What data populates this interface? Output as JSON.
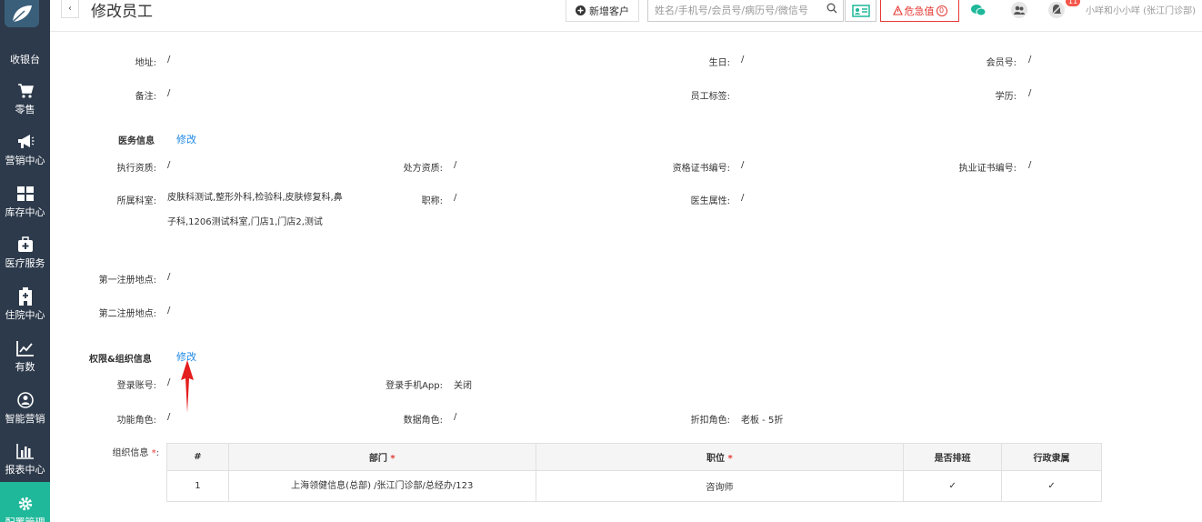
{
  "sidebar": {
    "items": [
      {
        "label": "收银台",
        "icon": "cashier-icon"
      },
      {
        "label": "零售",
        "icon": "cart-icon"
      },
      {
        "label": "营销中心",
        "icon": "megaphone-icon"
      },
      {
        "label": "库存中心",
        "icon": "grid-icon"
      },
      {
        "label": "医疗服务",
        "icon": "medkit-icon"
      },
      {
        "label": "住院中心",
        "icon": "hospital-icon"
      },
      {
        "label": "有数",
        "icon": "trend-icon"
      },
      {
        "label": "智能营销",
        "icon": "people-icon"
      },
      {
        "label": "报表中心",
        "icon": "bar-chart-icon"
      },
      {
        "label": "配置管理",
        "icon": "gear-icon"
      }
    ]
  },
  "header": {
    "title": "修改员工",
    "new_customer": "新增客户",
    "search_placeholder": "姓名/手机号/会员号/病历号/微信号",
    "critical_value": "危急值",
    "critical_count": "0",
    "user": "小咩和小小咩 (张江门诊部)",
    "badge": "11"
  },
  "basic": {
    "address_label": "地址:",
    "address_value": "/",
    "birthday_label": "生日:",
    "birthday_value": "/",
    "member_no_label": "会员号:",
    "member_no_value": "/",
    "remark_label": "备注:",
    "remark_value": "/",
    "staff_tag_label": "员工标签:",
    "education_label": "学历:",
    "education_value": "/"
  },
  "medical": {
    "section_title": "医务信息",
    "edit_link": "修改",
    "practice_qual_label": "执行资质:",
    "practice_qual_value": "/",
    "prescription_qual_label": "处方资质:",
    "prescription_qual_value": "/",
    "cert_no_label": "资格证书编号:",
    "cert_no_value": "/",
    "license_no_label": "执业证书编号:",
    "license_no_value": "/",
    "dept_label": "所属科室:",
    "dept_value": "皮肤科测试,整形外科,检验科,皮肤修复科,鼻子科,1206测试科室,门店1,门店2,测试",
    "title_label": "职称:",
    "title_value": "/",
    "doctor_attr_label": "医生属性:",
    "doctor_attr_value": "/",
    "first_reg_label": "第一注册地点:",
    "first_reg_value": "/",
    "second_reg_label": "第二注册地点:",
    "second_reg_value": "/"
  },
  "permission": {
    "section_title": "权限&组织信息",
    "edit_link": "修改",
    "login_account_label": "登录账号:",
    "login_account_value": "/",
    "login_app_label": "登录手机App:",
    "login_app_value": "关闭",
    "func_role_label": "功能角色:",
    "func_role_value": "/",
    "data_role_label": "数据角色:",
    "data_role_value": "/",
    "discount_role_label": "折扣角色:",
    "discount_role_value": "老板 - 5折",
    "org_label": "组织信息",
    "table": {
      "headers": [
        "#",
        "部门",
        "职位",
        "是否排班",
        "行政隶属"
      ],
      "rows": [
        {
          "no": "1",
          "dept": "上海领健信息(总部) /张江门诊部/总经办/123",
          "position": "咨询师",
          "scheduled": "✓",
          "admin": "✓"
        }
      ]
    }
  }
}
